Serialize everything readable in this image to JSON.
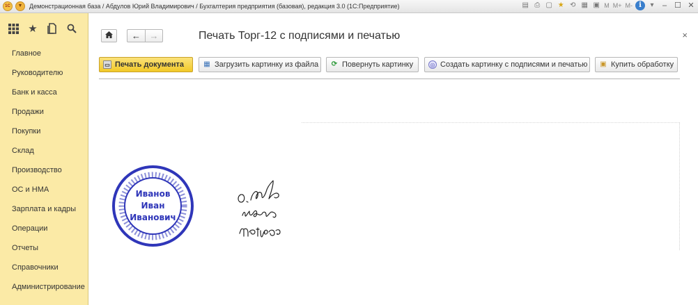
{
  "titlebar": {
    "logo": "1C",
    "title": "Демонстрационная база / Абдулов Юрий Владимирович / Бухгалтерия предприятия (базовая), редакция 3.0  (1С:Предприятие)",
    "calc_m": "M",
    "calc_mplus": "M+",
    "calc_mminus": "M-"
  },
  "sidebar": {
    "sections": [
      "Главное",
      "Руководителю",
      "Банк и касса",
      "Продажи",
      "Покупки",
      "Склад",
      "Производство",
      "ОС и НМА",
      "Зарплата и кадры",
      "Операции",
      "Отчеты",
      "Справочники",
      "Администрирование"
    ]
  },
  "main": {
    "title": "Печать Торг-12 с подписями и печатью",
    "buttons": {
      "print": "Печать документа",
      "load": "Загрузить картинку из файла",
      "rotate": "Повернуть картинку",
      "create": "Создать картинку с подписями и печатью",
      "buy": "Купить обработку"
    }
  },
  "stamp": {
    "lines": [
      "Иванов",
      "Иван",
      "Иванович"
    ],
    "color": "#2f36b9"
  },
  "colors": {
    "sidebar_bg": "#fbeaa6",
    "primary_button": "#f2c928"
  }
}
